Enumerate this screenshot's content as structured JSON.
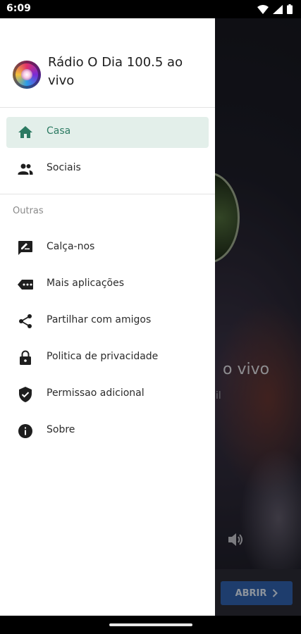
{
  "status_bar": {
    "time": "6:09"
  },
  "drawer": {
    "app_title": "Rádio O Dia 100.5 ao vivo",
    "main_items": [
      {
        "label": "Casa",
        "icon": "home-icon",
        "active": true
      },
      {
        "label": "Sociais",
        "icon": "people-icon",
        "active": false
      }
    ],
    "section_label": "Outras",
    "other_items": [
      {
        "label": "Calça-nos",
        "icon": "rate-icon"
      },
      {
        "label": "Mais aplicações",
        "icon": "more-apps-icon"
      },
      {
        "label": "Partilhar com amigos",
        "icon": "share-icon"
      },
      {
        "label": "Politica de privacidade",
        "icon": "lock-icon"
      },
      {
        "label": "Permissao adicional",
        "icon": "shield-check-icon"
      },
      {
        "label": "Sobre",
        "icon": "info-icon"
      }
    ]
  },
  "background": {
    "title_fragment": "o vivo",
    "subtitle_fragment": "il",
    "open_button_label": "ABRIR"
  },
  "colors": {
    "accent": "#2c7a62",
    "active_bg": "#e3efea",
    "open_button": "#2e5ea8"
  }
}
